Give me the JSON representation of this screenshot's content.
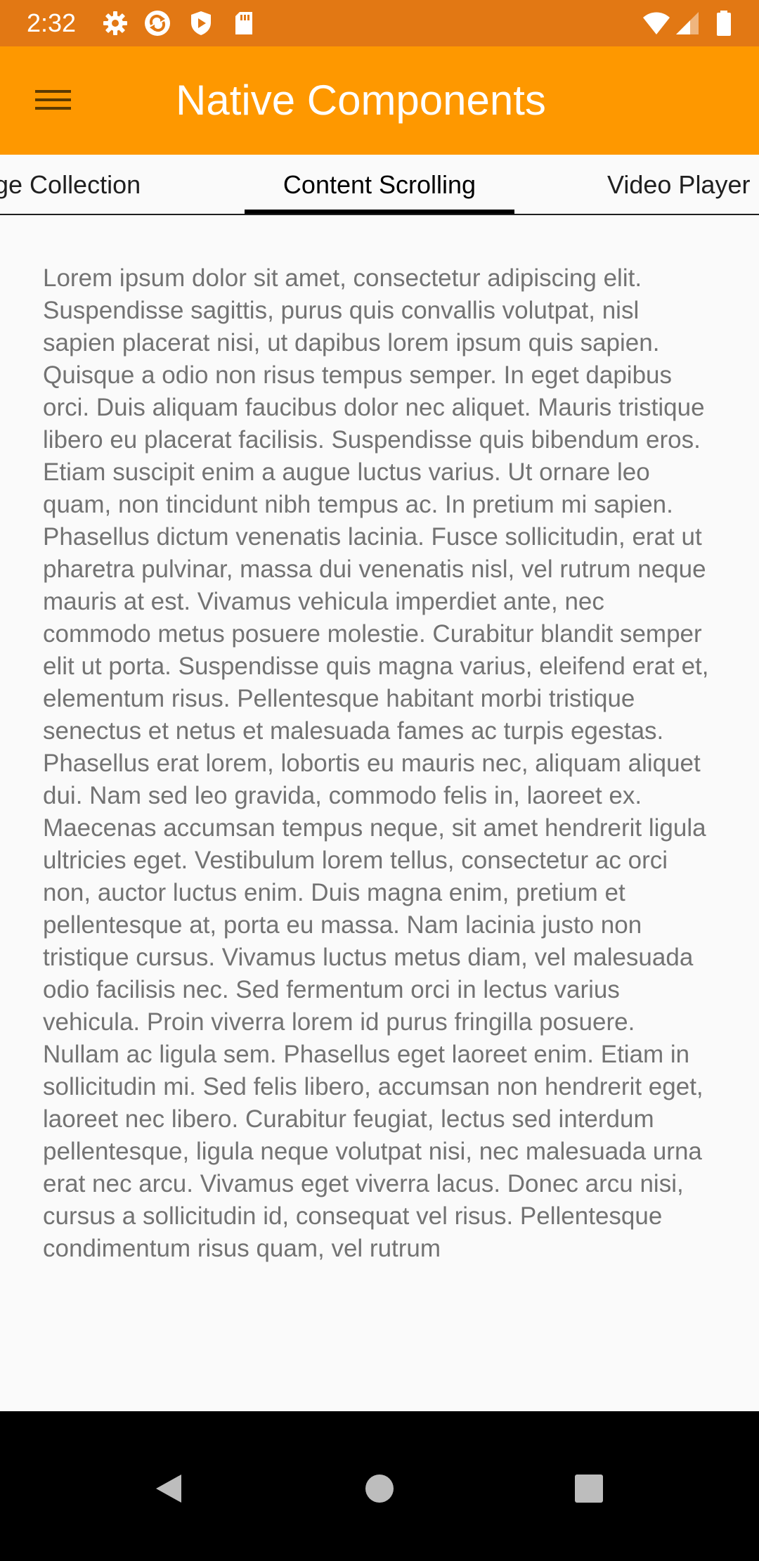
{
  "status_bar": {
    "time": "2:32",
    "left_icons": [
      "settings-icon",
      "sync-icon",
      "shield-icon",
      "sd-card-icon"
    ],
    "right_icons": [
      "wifi-icon",
      "cell-signal-icon",
      "battery-icon"
    ]
  },
  "app_bar": {
    "menu_icon": "hamburger-menu-icon",
    "title": "Native Components",
    "color": "#fe9800"
  },
  "tabs": [
    {
      "label": "ge Collection",
      "selected": false
    },
    {
      "label": "Content Scrolling",
      "selected": true
    },
    {
      "label": "Video Player",
      "selected": false
    }
  ],
  "content": {
    "text": "Lorem ipsum dolor sit amet, consectetur adipiscing elit. Suspendisse sagittis, purus quis convallis volutpat, nisl sapien placerat nisi, ut dapibus lorem ipsum quis sapien. Quisque a odio non risus tempus semper. In eget dapibus orci. Duis aliquam faucibus dolor nec aliquet. Mauris tristique libero eu placerat facilisis. Suspendisse quis bibendum eros. Etiam suscipit enim a augue luctus varius. Ut ornare leo quam, non tin­cidunt nibh tempus ac. In pretium mi sapien. Phasellus dictum venenatis lacinia. Fusce sollicitudin, erat ut pharetra pulvinar, massa dui venenatis nisl, vel rutrum neque mauris at est. Vivamus vehicula imperdiet ante, nec commodo metus posuere molestie. Curabitur blandit semper elit ut porta. Suspendisse quis magna varius, eleifend erat et, elementum risus. Pellentesque habitant morbi tristique senectus et netus et male­suada fames ac turpis egestas. Phasellus erat lorem, lobortis eu mauris nec, aliquam aliquet dui. Nam sed leo gravida, commodo felis in, laoreet ex. Maecenas accumsan tempus neque, sit amet hendrerit ligula ultricies eget. Vestibulum lorem tellus, consectetur ac orci non, auctor luctus enim. Duis magna enim, pretium et pellentesque at, porta eu massa. Nam lacinia justo non tristique cursus. Vivamus luctus metus diam, vel malesuada odio facilisis nec. Sed fermentum orci in lectus varius vehicula. Proin viverra lorem id purus fringilla posuere. Nullam ac ligula sem. Phasellus eget laoreet enim. Etiam in sollicitudin mi. Sed felis libero, accumsan non hendrerit eget, laoreet nec libero. Curabitur feugiat, lectus sed interdum pellentesque, ligula neque volutpat nisi, nec malesuada urna erat nec arcu. Vivamus eget viverra lacus. Donec arcu nisi, cursus a sollicitudin id, consequat vel risus. Pellentesque condimentum risus quam, vel rutrum"
  },
  "nav_bar": {
    "buttons": [
      "back-icon",
      "home-icon",
      "recents-icon"
    ]
  },
  "colors": {
    "status_bar": "#e27814",
    "app_bar": "#fe9800",
    "background": "#fafafa",
    "body_text": "#737373"
  }
}
